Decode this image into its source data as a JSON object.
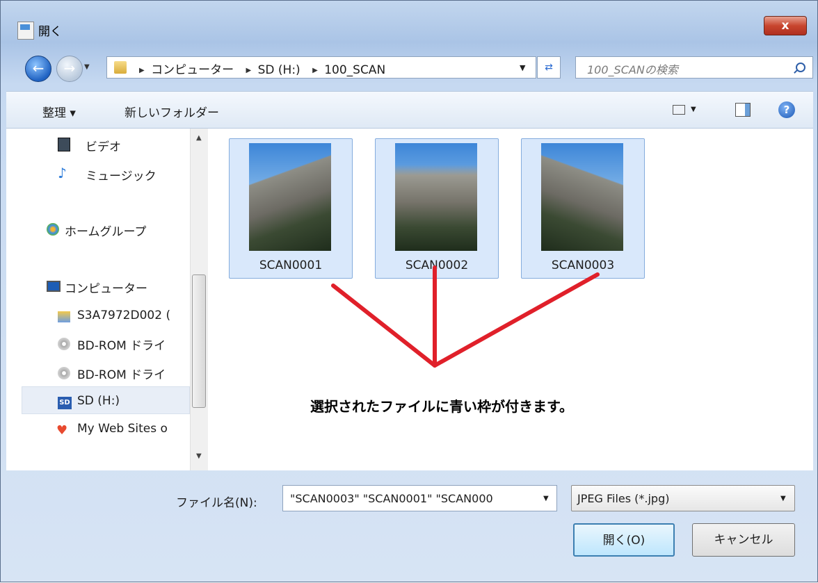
{
  "window": {
    "title": "開く",
    "close_label": "x"
  },
  "address": {
    "breadcrumbs": [
      "コンピューター",
      "SD (H:)",
      "100_SCAN"
    ],
    "search_placeholder": "100_SCANの検索"
  },
  "toolbar": {
    "organize_label": "整理 ▾",
    "new_folder_label": "新しいフォルダー"
  },
  "nav": {
    "items": [
      {
        "label": "ビデオ",
        "icon": "film-icon"
      },
      {
        "label": "ミュージック",
        "icon": "music-note-icon"
      },
      {
        "label": "ホームグループ",
        "icon": "homegroup-icon"
      },
      {
        "label": "コンピューター",
        "icon": "computer-icon"
      },
      {
        "label": "S3A7972D002 (",
        "icon": "drive-icon"
      },
      {
        "label": "BD-ROM ドライ",
        "icon": "disc-icon"
      },
      {
        "label": "BD-ROM ドライ",
        "icon": "disc-icon"
      },
      {
        "label": "SD (H:)",
        "icon": "sd-card-icon"
      },
      {
        "label": "My Web Sites o",
        "icon": "web-sites-icon"
      }
    ],
    "selected": "SD (H:)"
  },
  "files": [
    {
      "name": "SCAN0001",
      "selected": true
    },
    {
      "name": "SCAN0002",
      "selected": true
    },
    {
      "name": "SCAN0003",
      "selected": true
    }
  ],
  "annotation": {
    "text": "選択されたファイルに青い枠が付きます。",
    "color": "#e0202a"
  },
  "footer": {
    "filename_label": "ファイル名(N):",
    "filename_value": "\"SCAN0003\" \"SCAN0001\" \"SCAN000",
    "filetype_value": "JPEG Files (*.jpg)",
    "open_label": "開く(O)",
    "cancel_label": "キャンセル"
  },
  "colors": {
    "selection_fill": "#d9e8fb",
    "selection_border": "#84acdd",
    "chrome": "#c6d9f1"
  }
}
